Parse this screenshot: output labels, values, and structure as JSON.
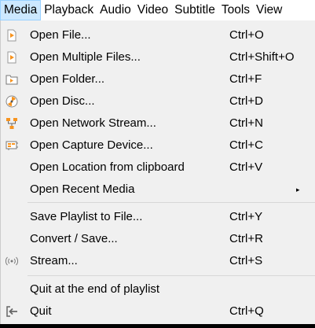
{
  "menubar": [
    "Media",
    "Playback",
    "Audio",
    "Video",
    "Subtitle",
    "Tools",
    "View"
  ],
  "items": [
    {
      "label": "Open File...",
      "shortcut": "Ctrl+O",
      "icon": "file-play-icon"
    },
    {
      "label": "Open Multiple Files...",
      "shortcut": "Ctrl+Shift+O",
      "icon": "files-play-icon"
    },
    {
      "label": "Open Folder...",
      "shortcut": "Ctrl+F",
      "icon": "folder-icon"
    },
    {
      "label": "Open Disc...",
      "shortcut": "Ctrl+D",
      "icon": "disc-icon"
    },
    {
      "label": "Open Network Stream...",
      "shortcut": "Ctrl+N",
      "icon": "network-icon"
    },
    {
      "label": "Open Capture Device...",
      "shortcut": "Ctrl+C",
      "icon": "capture-card-icon"
    },
    {
      "label": "Open Location from clipboard",
      "shortcut": "Ctrl+V"
    },
    {
      "label": "Open Recent Media",
      "shortcut": "",
      "submenu": "▸"
    },
    {
      "label": "Save Playlist to File...",
      "shortcut": "Ctrl+Y"
    },
    {
      "label": "Convert / Save...",
      "shortcut": "Ctrl+R"
    },
    {
      "label": "Stream...",
      "shortcut": "Ctrl+S",
      "icon": "stream-icon"
    },
    {
      "label": "Quit at the end of playlist",
      "shortcut": ""
    },
    {
      "label": "Quit",
      "shortcut": "Ctrl+Q",
      "icon": "quit-icon"
    }
  ],
  "colors": {
    "accent": "#f7931e",
    "highlight": "#cce8ff"
  }
}
